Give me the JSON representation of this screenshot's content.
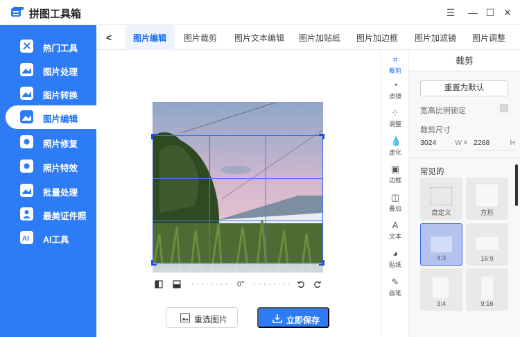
{
  "app": {
    "title": "拼图工具箱"
  },
  "window_controls": {
    "menu": "☰",
    "minimize": "—",
    "maximize": "☐",
    "close": "✕"
  },
  "sidebar": {
    "items": [
      {
        "label": "热门工具",
        "icon": "hot-tools-icon"
      },
      {
        "label": "图片处理",
        "icon": "image-process-icon"
      },
      {
        "label": "图片转换",
        "icon": "image-convert-icon"
      },
      {
        "label": "图片编辑",
        "icon": "image-edit-icon",
        "active": true
      },
      {
        "label": "照片修复",
        "icon": "photo-repair-icon"
      },
      {
        "label": "照片特效",
        "icon": "photo-effect-icon"
      },
      {
        "label": "批量处理",
        "icon": "batch-icon"
      },
      {
        "label": "最美证件照",
        "icon": "id-photo-icon"
      },
      {
        "label": "AI工具",
        "icon": "ai-icon"
      }
    ]
  },
  "tabs": {
    "back": "<",
    "items": [
      "图片编辑",
      "图片裁剪",
      "图片文本编辑",
      "图片加贴纸",
      "图片加边框",
      "图片加滤镜",
      "图片调整"
    ],
    "active_index": 0
  },
  "canvas": {
    "angle": "0°"
  },
  "buttons": {
    "reselect": "重选图片",
    "save": "立即保存"
  },
  "tools": [
    {
      "label": "裁剪",
      "glyph": "⌗",
      "active": true
    },
    {
      "label": "滤镜",
      "glyph": "◔"
    },
    {
      "label": "调整",
      "glyph": "⁘"
    },
    {
      "label": "虚化",
      "glyph": "💧"
    },
    {
      "label": "边框",
      "glyph": "▣"
    },
    {
      "label": "叠加",
      "glyph": "◫"
    },
    {
      "label": "文本",
      "glyph": "A"
    },
    {
      "label": "贴纸",
      "glyph": "◕"
    },
    {
      "label": "画笔",
      "glyph": "✎"
    }
  ],
  "panel": {
    "title": "裁剪",
    "reset": "重置为默认",
    "lock_label": "宽高比例锁定",
    "size_label": "裁剪尺寸",
    "width": "3024",
    "width_unit": "W",
    "x": "x",
    "height": "2268",
    "height_unit": "H",
    "common_label": "常见的",
    "ratios": [
      "自定义",
      "方形",
      "4:3",
      "16:9",
      "3:4",
      "9:16"
    ],
    "active_ratio": "4:3"
  },
  "colors": {
    "brand": "#2d7cf6",
    "accent": "#1b6ff0",
    "crop": "#3b6cf0"
  }
}
